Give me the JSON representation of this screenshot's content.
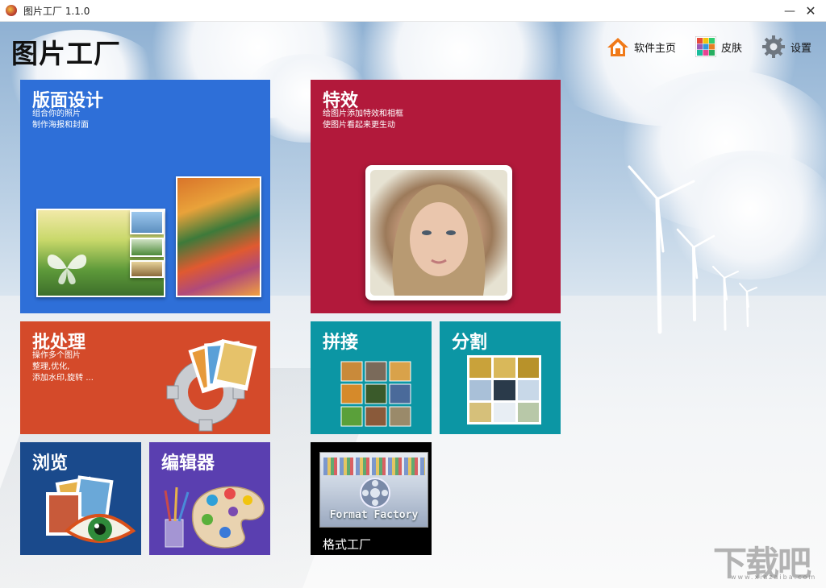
{
  "window": {
    "title": "图片工厂 1.1.0",
    "minimize": "—",
    "close": "✕"
  },
  "app": {
    "heading": "图片工厂"
  },
  "toolbar": {
    "home": "软件主页",
    "skin": "皮肤",
    "settings": "设置"
  },
  "tiles": {
    "layout": {
      "title": "版面设计",
      "desc1": "组合你的照片",
      "desc2": "制作海报和封面"
    },
    "effect": {
      "title": "特效",
      "desc1": "给图片添加特效和相框",
      "desc2": "使图片看起来更生动"
    },
    "batch": {
      "title": "批处理",
      "desc1": "操作多个图片",
      "desc2": "整理,优化,",
      "desc3": "添加水印,旋转 ..."
    },
    "stitch": {
      "title": "拼接"
    },
    "split": {
      "title": "分割"
    },
    "browse": {
      "title": "浏览"
    },
    "editor": {
      "title": "编辑器"
    },
    "factory": {
      "title": "格式工厂",
      "logo_text": "Format Factory"
    }
  },
  "watermark": {
    "text": "下载吧",
    "url": "www.xiazaiba.com"
  },
  "colors": {
    "layout": "#2e6fd8",
    "effect": "#b2193b",
    "batch": "#d44a2a",
    "stitch": "#0c96a4",
    "browse": "#1a4a8c",
    "editor": "#5a3fb0",
    "factory": "#000000"
  }
}
